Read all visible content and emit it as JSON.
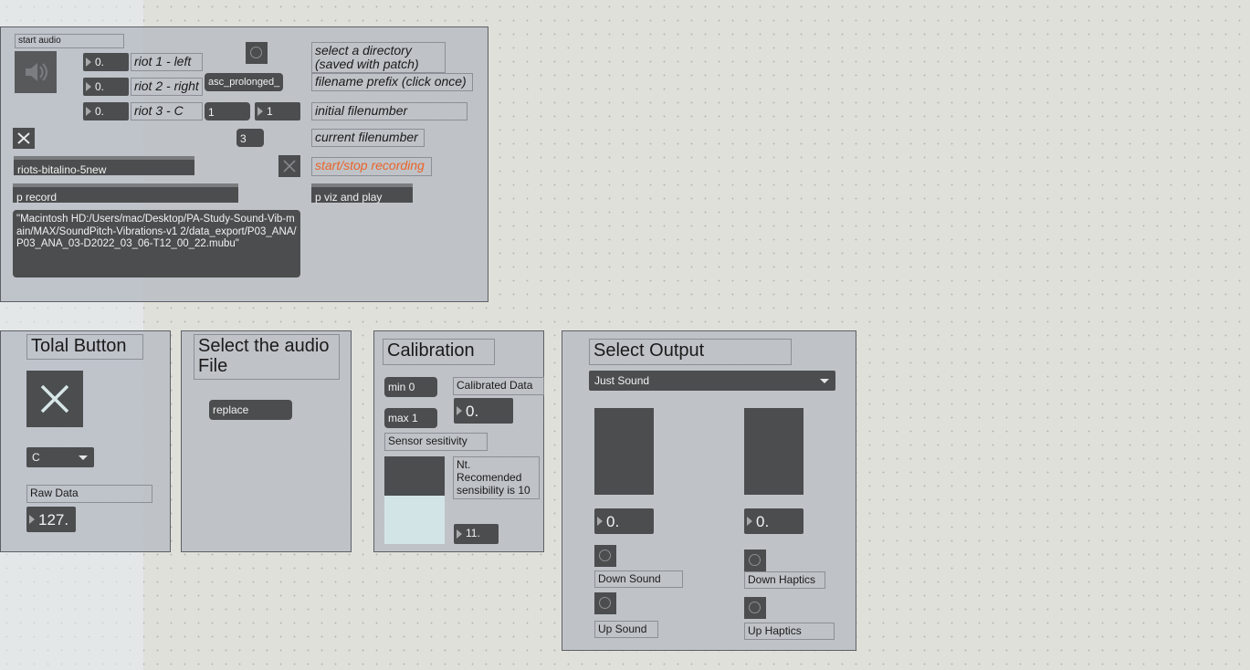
{
  "patch": {
    "start_audio_label": "start audio",
    "riots": [
      {
        "value": "0.",
        "label": "riot 1 - left"
      },
      {
        "value": "0.",
        "label": "riot 2 - right"
      },
      {
        "value": "0.",
        "label": "riot 3 - C"
      }
    ],
    "prefix_message": "asc_prolonged_",
    "filenumber_left": "1",
    "filenumber_right": "1",
    "current_filenumber": "3",
    "select_directory_comment": "select a directory\n(saved with patch)",
    "filename_prefix_comment": "filename prefix (click once)",
    "initial_filenumber_comment": "initial filenumber",
    "current_filenumber_comment": "current filenumber",
    "start_stop_comment": "start/stop recording",
    "start_stop_color": "#e8642a",
    "riots_object": "riots-bitalino-5new",
    "record_object": "p record",
    "viz_object": "p viz and play",
    "filepath_message": "\"Macintosh HD:/Users/mac/Desktop/PA-Study-Sound-Vib-main/MAX/SoundPitch-Vibrations-v1 2/data_export/P03_ANA/P03_ANA_03-D2022_03_06-T12_00_22.mubu\""
  },
  "total_button": {
    "title": "Tolal Button",
    "menu_value": "C",
    "raw_data_label": "Raw Data",
    "raw_data_value": "127."
  },
  "audio_file": {
    "title": "Select the audio File",
    "replace_label": "replace"
  },
  "calibration": {
    "title": "Calibration",
    "min_label": "min 0",
    "max_label": "max 1",
    "calibrated_label": "Calibrated Data",
    "calibrated_value": "0.",
    "sensitivity_label": "Sensor sesitivity",
    "note": "Nt.\nRecomended\nsensibility is 10",
    "sensitivity_value": "11.",
    "slider_level": 0.55
  },
  "output": {
    "title": "Select Output",
    "menu_value": "Just Sound",
    "left_value": "0.",
    "right_value": "0.",
    "down_sound": "Down Sound",
    "up_sound": "Up Sound",
    "down_haptics": "Down Haptics",
    "up_haptics": "Up Haptics"
  }
}
